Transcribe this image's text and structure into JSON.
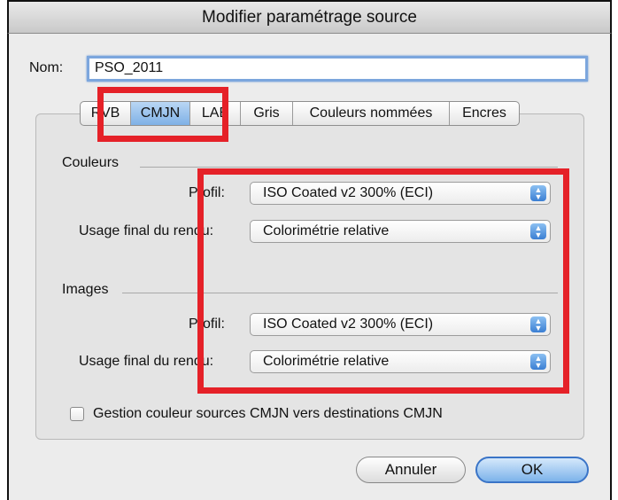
{
  "window": {
    "title": "Modifier paramétrage source"
  },
  "name_field": {
    "label": "Nom:",
    "value": "PSO_2011"
  },
  "tabs": [
    {
      "label": "RVB",
      "selected": false
    },
    {
      "label": "CMJN",
      "selected": true
    },
    {
      "label": "LAB",
      "selected": false
    },
    {
      "label": "Gris",
      "selected": false
    },
    {
      "label": "Couleurs nommées",
      "selected": false
    },
    {
      "label": "Encres",
      "selected": false
    }
  ],
  "couleurs": {
    "heading": "Couleurs",
    "profil_label": "Profil:",
    "profil_value": "ISO Coated v2 300% (ECI)",
    "usage_label": "Usage final du rendu:",
    "usage_value": "Colorimétrie relative"
  },
  "images": {
    "heading": "Images",
    "profil_label": "Profil:",
    "profil_value": "ISO Coated v2 300% (ECI)",
    "usage_label": "Usage final du rendu:",
    "usage_value": "Colorimétrie relative"
  },
  "checkbox": {
    "label": "Gestion couleur sources CMJN vers destinations CMJN",
    "checked": false
  },
  "buttons": {
    "cancel": "Annuler",
    "ok": "OK"
  },
  "colors": {
    "highlight_red": "#e52128",
    "selected_tab": "#7fb1e6",
    "focus_ring": "#7ca6dd"
  }
}
